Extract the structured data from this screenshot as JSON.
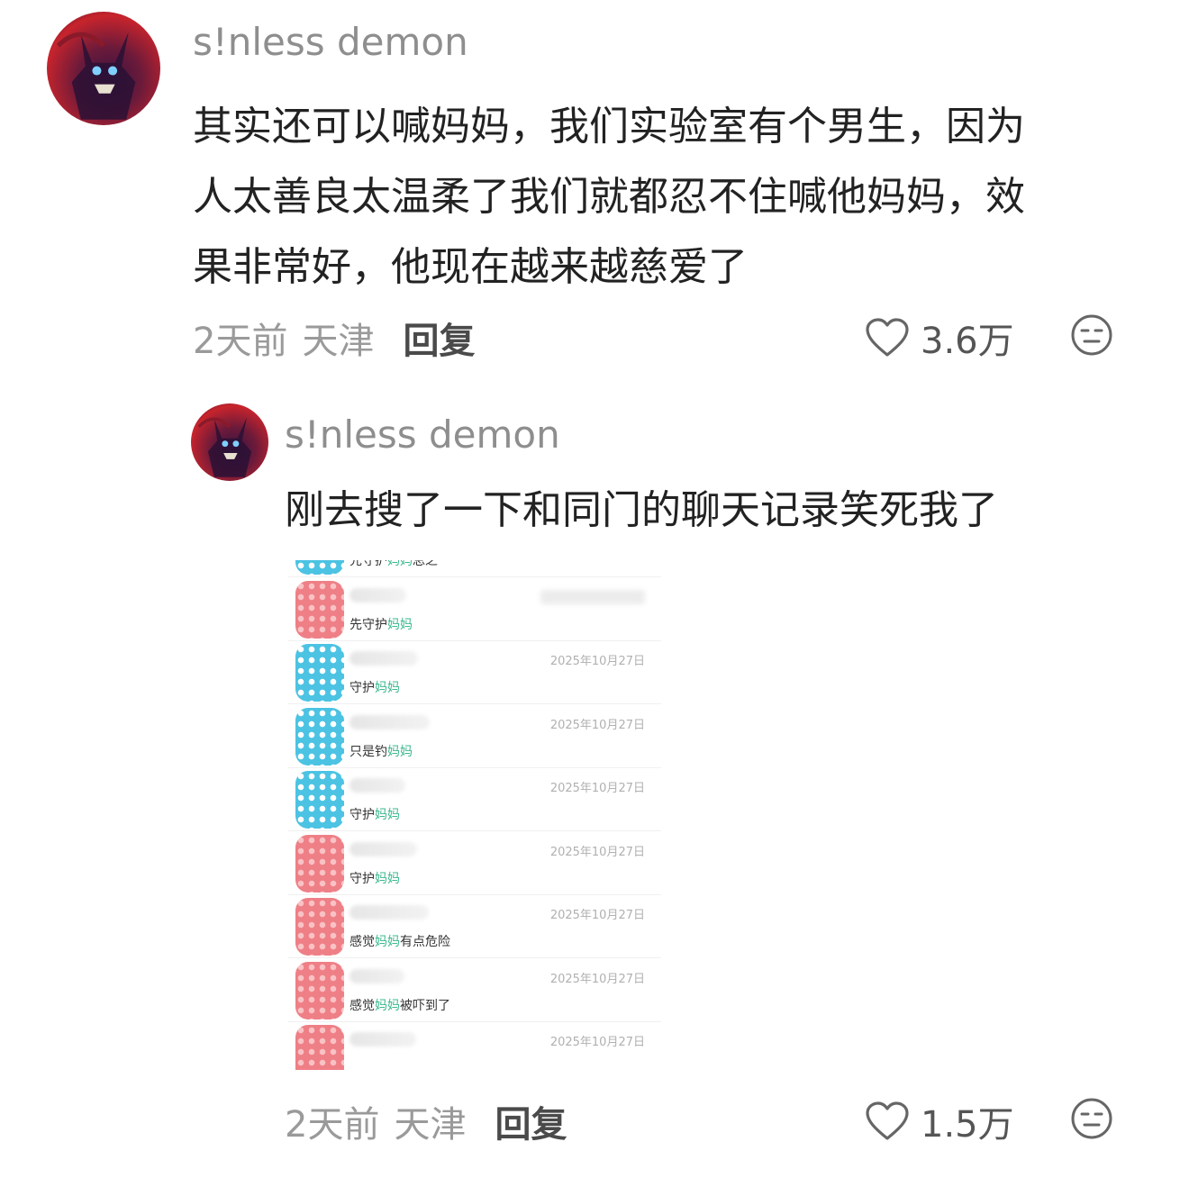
{
  "comments": [
    {
      "username": "s!nless demon",
      "text_lines": [
        "其实还可以喊妈妈，我们实验室有个男生，因为",
        "人太善良太温柔了我们就都忍不住喊他妈妈，效",
        "果非常好，他现在越来越慈爱了"
      ],
      "time": "2天前",
      "location": "天津",
      "reply_label": "回复",
      "likes": "3.6万",
      "like_icon": "heart-outline-icon",
      "reaction_icon": "neutral-face-icon"
    },
    {
      "username": "s!nless demon",
      "text": "刚去搜了一下和同门的聊天记录笑死我了",
      "time": "2天前",
      "location": "天津",
      "reply_label": "回复",
      "likes": "1.5万",
      "like_icon": "heart-outline-icon",
      "reaction_icon": "neutral-face-icon"
    }
  ],
  "chat_screenshot": {
    "rows": [
      {
        "avatar": "blue",
        "pre": "先守护",
        "hl": "妈妈",
        "post": "总之",
        "date": ""
      },
      {
        "avatar": "pink",
        "pre": "先守护",
        "hl": "妈妈",
        "post": "",
        "date": "blurred"
      },
      {
        "avatar": "blue",
        "pre": "守护",
        "hl": "妈妈",
        "post": "",
        "date": "2025年10月27日"
      },
      {
        "avatar": "blue",
        "pre": "只是钓",
        "hl": "妈妈",
        "post": "",
        "date": "2025年10月27日"
      },
      {
        "avatar": "blue",
        "pre": "守护",
        "hl": "妈妈",
        "post": "",
        "date": "2025年10月27日"
      },
      {
        "avatar": "pink",
        "pre": "守护",
        "hl": "妈妈",
        "post": "",
        "date": "2025年10月27日"
      },
      {
        "avatar": "pink",
        "pre": "感觉",
        "hl": "妈妈",
        "post": "有点危险",
        "date": "2025年10月27日"
      },
      {
        "avatar": "pink",
        "pre": "感觉",
        "hl": "妈妈",
        "post": "被吓到了",
        "date": "2025年10月27日"
      },
      {
        "avatar": "pink",
        "pre": "",
        "hl": "",
        "post": "",
        "date": "2025年10月27日"
      }
    ]
  }
}
